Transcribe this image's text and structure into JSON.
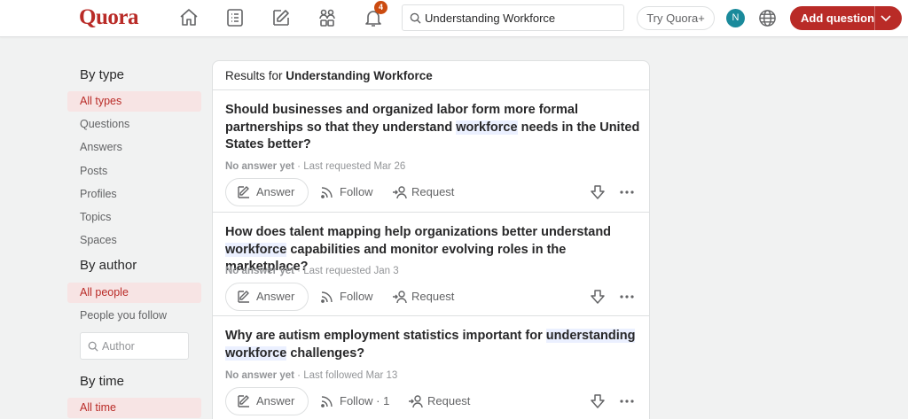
{
  "header": {
    "logo": "Quora",
    "notification_count": "4",
    "search_value": "Understanding Workforce",
    "try_label": "Try Quora+",
    "avatar_initial": "N",
    "add_question_label": "Add question",
    "brand_color": "#b92b27"
  },
  "sidebar": {
    "by_type_title": "By type",
    "type_items": [
      "All types",
      "Questions",
      "Answers",
      "Posts",
      "Profiles",
      "Topics",
      "Spaces"
    ],
    "by_author_title": "By author",
    "author_items": [
      "All people",
      "People you follow"
    ],
    "author_placeholder": "Author",
    "by_time_title": "By time",
    "time_items": [
      "All time"
    ]
  },
  "results": {
    "prefix": "Results for",
    "query": "Understanding Workforce",
    "questions": [
      {
        "title_before": "Should businesses and organized labor form more formal partnerships so that they understand ",
        "title_highlight": "workforce",
        "title_after": " needs in the United States better?",
        "no_answer": "No answer yet",
        "meta": " · Last requested Mar 26",
        "answer_label": "Answer",
        "follow_label": "Follow",
        "request_label": "Request"
      },
      {
        "title_before": "How does talent mapping help organizations better understand ",
        "title_highlight": "workforce",
        "title_after": " capabilities and monitor evolving roles in the marketplace?",
        "no_answer": "No answer yet",
        "meta": " · Last requested Jan 3",
        "answer_label": "Answer",
        "follow_label": "Follow",
        "request_label": "Request"
      },
      {
        "title_before": "Why are autism employment statistics important for ",
        "title_highlight": "understanding workforce",
        "title_after": " challenges?",
        "no_answer": "No answer yet",
        "meta": " · Last followed Mar 13",
        "answer_label": "Answer",
        "follow_label": "Follow · 1",
        "request_label": "Request"
      }
    ]
  }
}
